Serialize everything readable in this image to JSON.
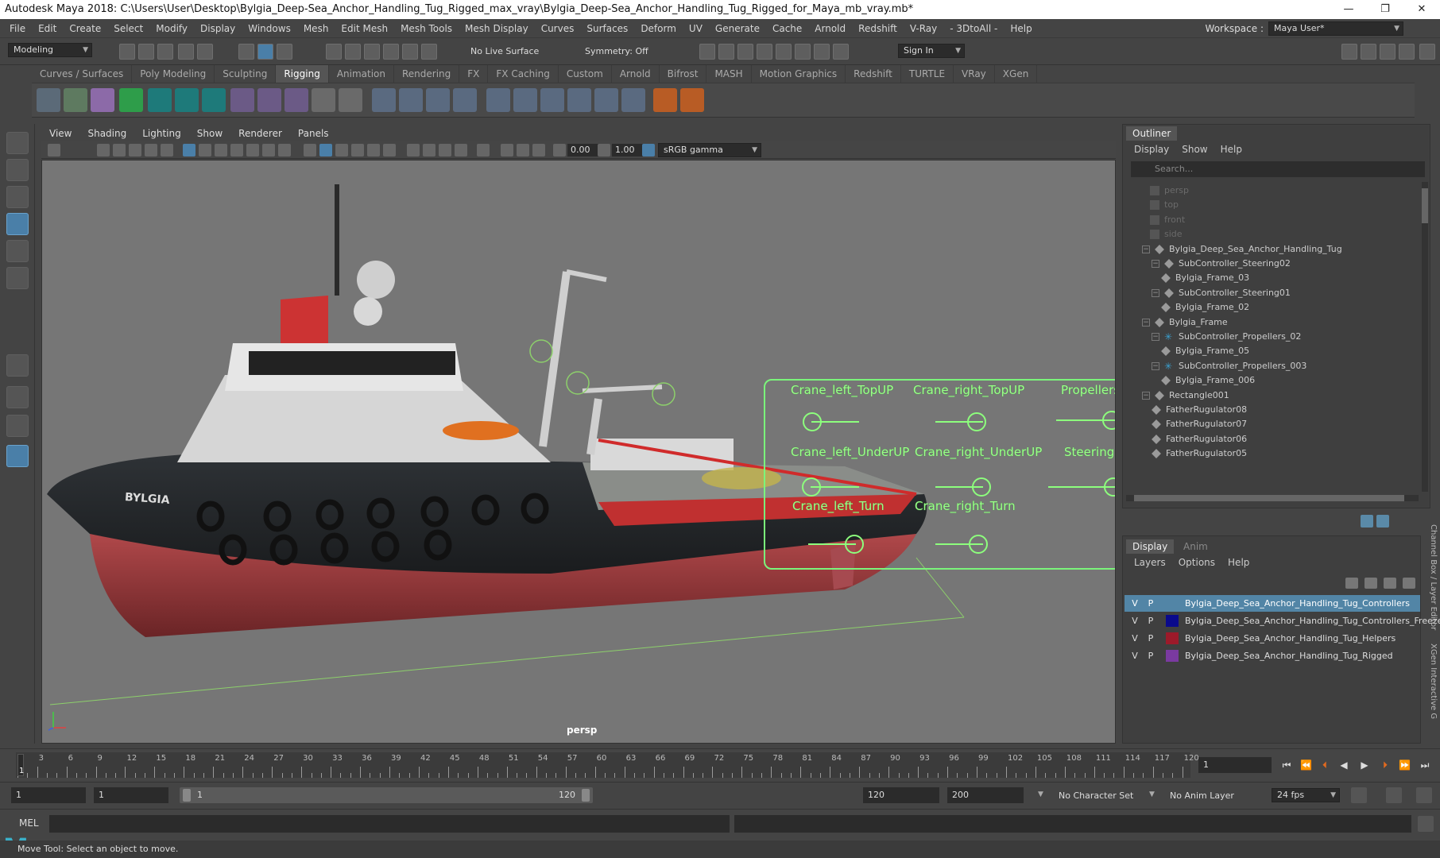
{
  "window": {
    "title": "Autodesk Maya 2018: C:\\Users\\User\\Desktop\\Bylgia_Deep-Sea_Anchor_Handling_Tug_Rigged_max_vray\\Bylgia_Deep-Sea_Anchor_Handling_Tug_Rigged_for_Maya_mb_vray.mb*",
    "minimize": "—",
    "maximize": "❐",
    "close": "✕"
  },
  "menubar": {
    "items": [
      "File",
      "Edit",
      "Create",
      "Select",
      "Modify",
      "Display",
      "Windows",
      "Mesh",
      "Edit Mesh",
      "Mesh Tools",
      "Mesh Display",
      "Curves",
      "Surfaces",
      "Deform",
      "UV",
      "Generate",
      "Cache",
      "Arnold",
      "Redshift",
      "V-Ray",
      "- 3DtoAll -",
      "Help"
    ],
    "workspace_label": "Workspace :",
    "workspace_value": "Maya User*"
  },
  "statusline": {
    "mode": "Modeling",
    "live_surface": "No Live Surface",
    "symmetry": "Symmetry: Off",
    "sign_in": "Sign In"
  },
  "shelf": {
    "tabs": [
      "Curves / Surfaces",
      "Poly Modeling",
      "Sculpting",
      "Rigging",
      "Animation",
      "Rendering",
      "FX",
      "FX Caching",
      "Custom",
      "Arnold",
      "Bifrost",
      "MASH",
      "Motion Graphics",
      "Redshift",
      "TURTLE",
      "VRay",
      "XGen"
    ],
    "active_tab": "Rigging"
  },
  "viewport": {
    "menus": [
      "View",
      "Shading",
      "Lighting",
      "Show",
      "Renderer",
      "Panels"
    ],
    "near_value": "0.00",
    "far_value": "1.00",
    "color_space": "sRGB gamma",
    "camera_label": "persp",
    "ship_name": "BYLGIA"
  },
  "controllers": {
    "labels": [
      "Crane_left_TopUP",
      "Crane_right_TopUP",
      "Propellers",
      "Crane_left_UnderUP",
      "Crane_right_UnderUP",
      "Steering",
      "Crane_left_Turn",
      "Crane_right_Turn"
    ],
    "color": "#8dff7d"
  },
  "outliner": {
    "title": "Outliner",
    "menu": [
      "Display",
      "Show",
      "Help"
    ],
    "search_placeholder": "Search...",
    "rows": [
      {
        "label": "persp"
      },
      {
        "label": "top"
      },
      {
        "label": "front"
      },
      {
        "label": "side"
      },
      {
        "label": "Bylgia_Deep_Sea_Anchor_Handling_Tug"
      },
      {
        "label": "SubController_Steering02"
      },
      {
        "label": "Bylgia_Frame_03"
      },
      {
        "label": "SubController_Steering01"
      },
      {
        "label": "Bylgia_Frame_02"
      },
      {
        "label": "Bylgia_Frame"
      },
      {
        "label": "SubController_Propellers_02"
      },
      {
        "label": "Bylgia_Frame_05"
      },
      {
        "label": "SubController_Propellers_003"
      },
      {
        "label": "Bylgia_Frame_006"
      },
      {
        "label": "Rectangle001"
      },
      {
        "label": "FatherRugulator08"
      },
      {
        "label": "FatherRugulator07"
      },
      {
        "label": "FatherRugulator06"
      },
      {
        "label": "FatherRugulator05"
      }
    ]
  },
  "layers": {
    "tabs": [
      "Display",
      "Anim"
    ],
    "menu": [
      "Layers",
      "Options",
      "Help"
    ],
    "side_tab": "Channel Box / Layer Editor",
    "side_tab2": "XGen Interactive G",
    "rows": [
      {
        "v": "V",
        "p": "P",
        "color": "#5285a6",
        "name": "Bylgia_Deep_Sea_Anchor_Handling_Tug_Controllers"
      },
      {
        "v": "V",
        "p": "P",
        "color": "#0a0a8c",
        "name": "Bylgia_Deep_Sea_Anchor_Handling_Tug_Controllers_Freeze"
      },
      {
        "v": "V",
        "p": "P",
        "color": "#9c1a2a",
        "name": "Bylgia_Deep_Sea_Anchor_Handling_Tug_Helpers"
      },
      {
        "v": "V",
        "p": "P",
        "color": "#7a3aa0",
        "name": "Bylgia_Deep_Sea_Anchor_Handling_Tug_Rigged"
      }
    ]
  },
  "timeline": {
    "ticks": [
      "3",
      "6",
      "9",
      "12",
      "15",
      "18",
      "21",
      "24",
      "27",
      "30",
      "33",
      "36",
      "39",
      "42",
      "45",
      "48",
      "51",
      "54",
      "57",
      "60",
      "63",
      "66",
      "69",
      "72",
      "75",
      "78",
      "81",
      "84",
      "87",
      "90",
      "93",
      "96",
      "99",
      "102",
      "105",
      "108",
      "111",
      "114",
      "117",
      "120"
    ],
    "current_frame_label": "1",
    "current_frame": "1"
  },
  "range": {
    "start": "1",
    "playback_start": "1",
    "bar_start": "1",
    "bar_end": "120",
    "playback_end": "120",
    "end": "200",
    "character_set": "No Character Set",
    "anim_layer": "No Anim Layer",
    "fps": "24 fps"
  },
  "cmdline": {
    "label": "MEL"
  },
  "helpline": {
    "text": "Move Tool: Select an object to move."
  }
}
